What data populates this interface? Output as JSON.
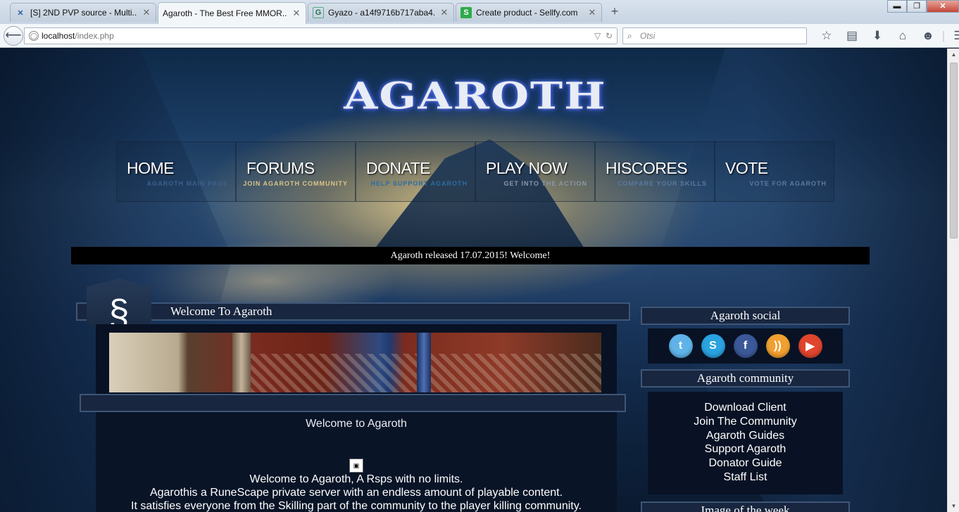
{
  "browser": {
    "tabs": [
      {
        "title": "[S] 2ND PVP source - Multi...",
        "icon": "crossed-swords-icon"
      },
      {
        "title": "Agaroth - The Best Free MMOR...",
        "icon": "none"
      },
      {
        "title": "Gyazo - a14f9716b717aba4...",
        "icon": "gyazo-icon"
      },
      {
        "title": "Create product - Sellfy.com",
        "icon": "sellfy-icon"
      }
    ],
    "new_tab": "+",
    "url_host": "localhost",
    "url_path": "/index.php",
    "search_placeholder": "Otsi",
    "window_buttons": {
      "minimize": "▬",
      "maximize": "❐",
      "close": "✕"
    }
  },
  "site": {
    "logo_text": "AGAROTH",
    "nav": [
      {
        "label": "HOME",
        "sub": "AGAROTH MAIN PAGE",
        "sub_color": "#3d5f8a"
      },
      {
        "label": "FORUMS",
        "sub": "JOIN AGAROTH COMMUNITY",
        "sub_color": "#d9c48a"
      },
      {
        "label": "DONATE",
        "sub": "HELP SUPPORT AGAROTH",
        "sub_color": "#2c6da0"
      },
      {
        "label": "PLAY NOW",
        "sub": "GET INTO THE ACTION",
        "sub_color": "#8a97a8"
      },
      {
        "label": "HISCORES",
        "sub": "COMPARE YOUR SKILLS",
        "sub_color": "#5a7aa0"
      },
      {
        "label": "VOTE",
        "sub": "VOTE FOR AGAROTH",
        "sub_color": "#5a7aa0"
      }
    ],
    "news": "Agaroth released 17.07.2015! Welcome!",
    "welcome_header": "Welcome To Agaroth",
    "content": {
      "title": "Welcome to Agaroth",
      "lines": [
        "Welcome to Agaroth, A Rsps with no limits.",
        "Agarothis a RuneScape private server with an endless amount of playable content.",
        "It satisfies everyone from the Skilling part of the community to the player killing community."
      ]
    },
    "sidebar": {
      "social_title": "Agaroth social",
      "social": [
        {
          "name": "twitter",
          "glyph": "t",
          "color": "#5fb3e8"
        },
        {
          "name": "skype",
          "glyph": "S",
          "color": "#2aa3e0"
        },
        {
          "name": "facebook",
          "glyph": "f",
          "color": "#3b5998"
        },
        {
          "name": "rss",
          "glyph": "))",
          "color": "#f0a030"
        },
        {
          "name": "youtube",
          "glyph": "▶",
          "color": "#e0452e"
        }
      ],
      "community_title": "Agaroth community",
      "community_links": [
        "Download Client",
        "Join The Community",
        "Agaroth Guides",
        "Support Agaroth",
        "Donator Guide",
        "Staff List"
      ],
      "image_title": "Image of the week"
    }
  }
}
